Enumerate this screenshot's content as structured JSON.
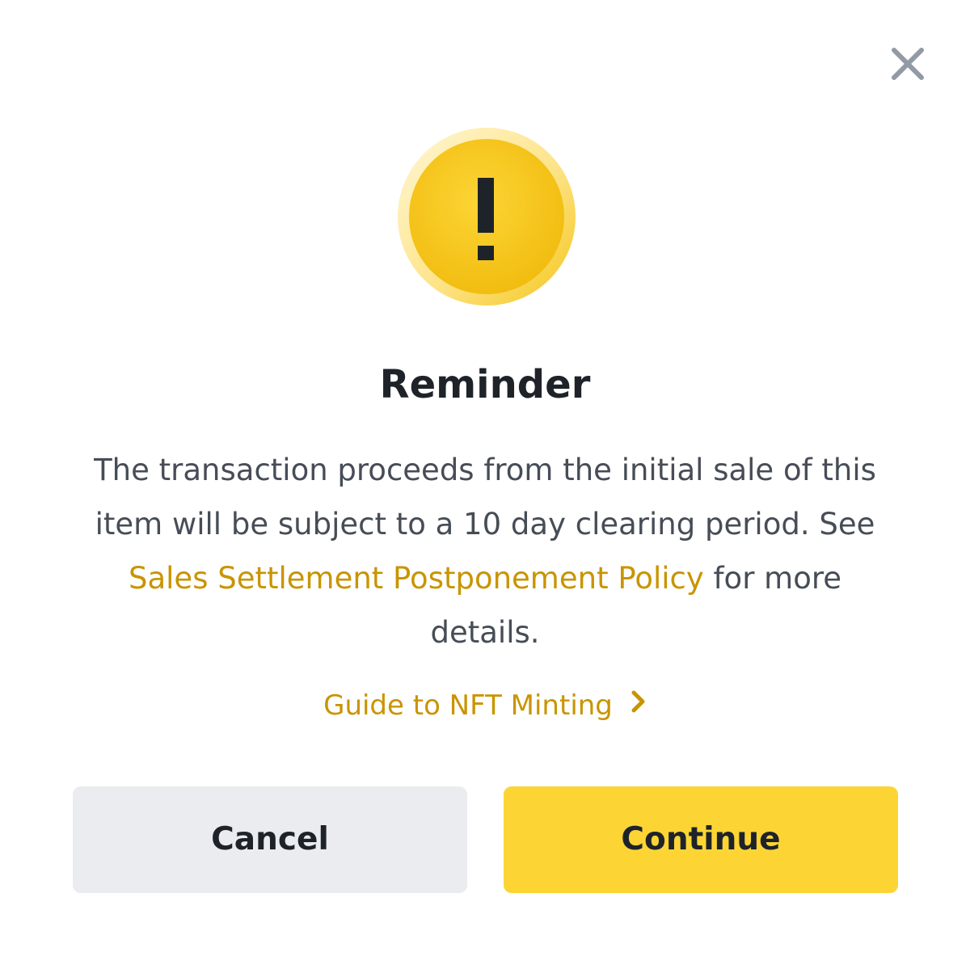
{
  "dialog": {
    "title": "Reminder",
    "body_before_link": "The transaction proceeds from the initial sale of this item will be subject to a 10 day clearing period. See ",
    "policy_link_label": "Sales Settlement Postponement Policy",
    "body_after_link": " for more details.",
    "guide_link_label": "Guide to NFT Minting",
    "cancel_label": "Cancel",
    "continue_label": "Continue",
    "icons": {
      "close": "close-icon",
      "alert": "exclamation-warning-icon",
      "guide_arrow": "chevron-right-icon"
    }
  },
  "colors": {
    "accent": "#c99400",
    "primary_button": "#fcd535",
    "secondary_button": "#eaecef",
    "warning_circle": "#f0b90b",
    "title_text": "#1e2329",
    "body_text": "#474d57",
    "close_icon": "#929aa5"
  }
}
